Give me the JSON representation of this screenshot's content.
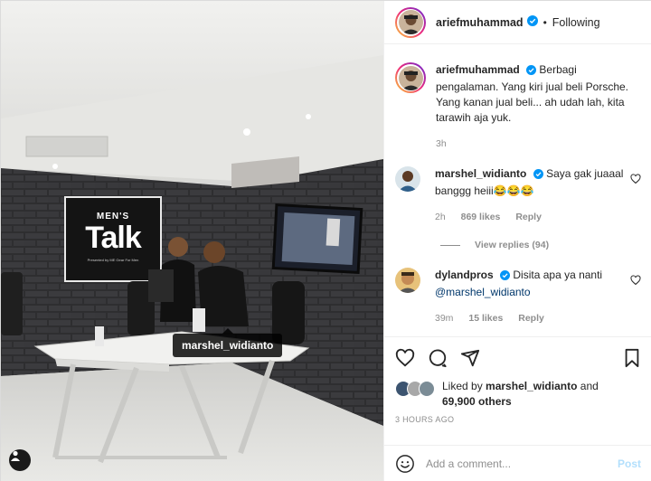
{
  "post": {
    "author": "ariefmuhammad",
    "follow_state": "Following",
    "separator": "•",
    "caption_author": "ariefmuhammad",
    "caption": "Berbagi pengalaman. Yang kiri jual beli Porsche. Yang kanan jual beli... ah udah lah, kita tarawih aja yuk.",
    "caption_time": "3h"
  },
  "photo": {
    "tagged_user": "marshel_widianto",
    "sign_line1": "MEN'S",
    "sign_line2": "Talk",
    "sign_sub": "Presented by ME Gear For Men"
  },
  "comments": [
    {
      "user": "marshel_widianto",
      "verified": true,
      "text": "Saya gak juaaal banggg heiii😂😂😂",
      "time": "2h",
      "likes": "869 likes",
      "reply": "Reply",
      "view_replies": "View replies (94)"
    },
    {
      "user": "dylandpros",
      "verified": true,
      "text": "Disita apa ya nanti",
      "mention": "@marshel_widianto",
      "time": "39m",
      "likes": "15 likes",
      "reply": "Reply"
    }
  ],
  "likes_summary": {
    "prefix": "Liked by",
    "user": "marshel_widianto",
    "connector": "and",
    "others": "69,900 others"
  },
  "timestamp": "3 HOURS AGO",
  "add_comment": {
    "placeholder": "Add a comment...",
    "post_label": "Post"
  },
  "colors": {
    "verified_blue": "#0095f6",
    "post_disabled": "#b2dffc",
    "meta_gray": "#8e8e8e"
  },
  "icons": [
    "verified-icon",
    "heart-icon",
    "comment-icon",
    "share-icon",
    "bookmark-icon",
    "emoji-icon",
    "tag-user-icon"
  ]
}
